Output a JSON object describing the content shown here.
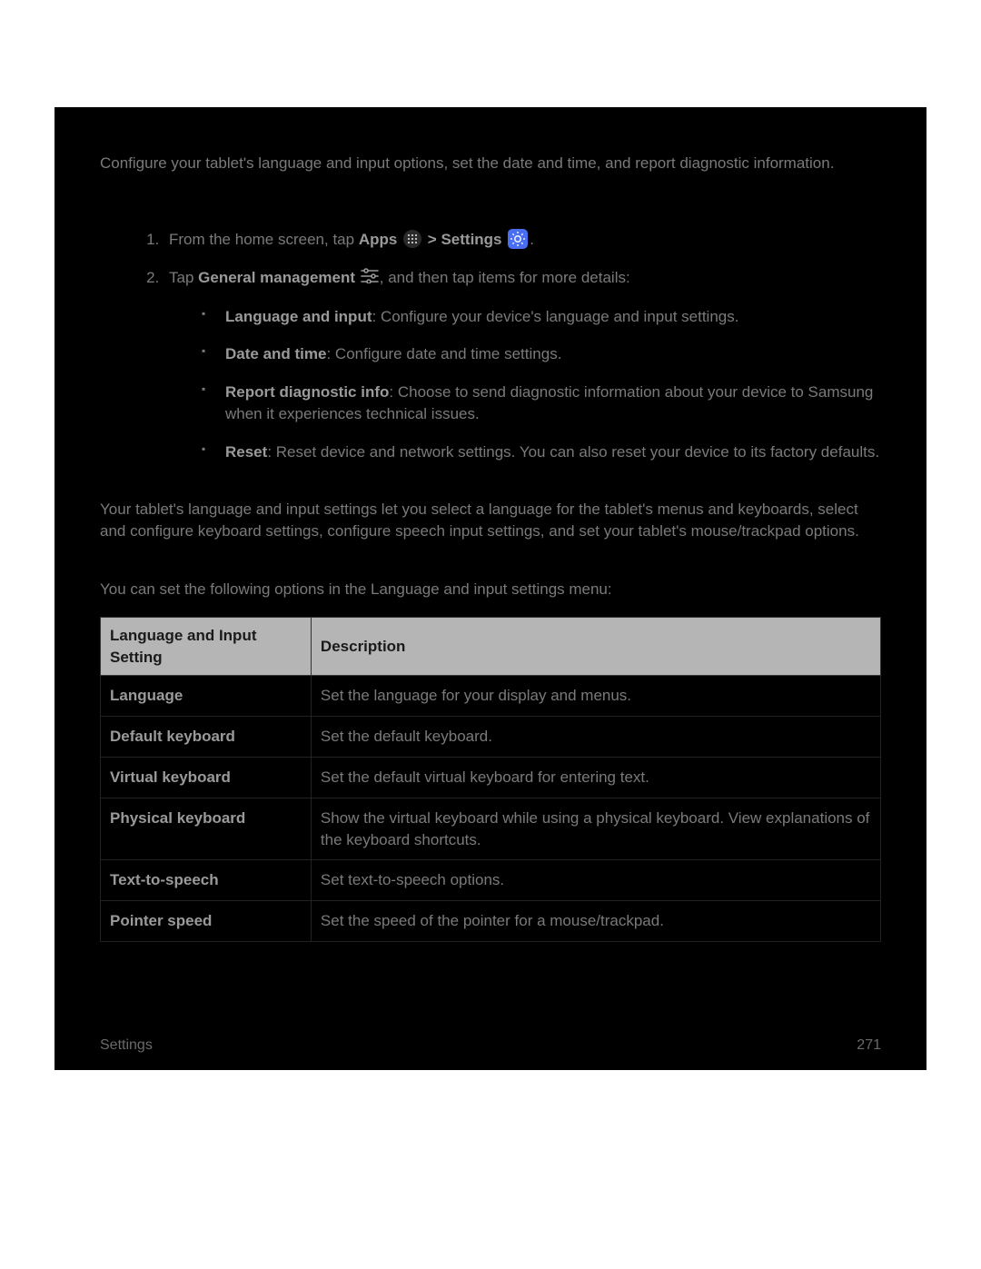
{
  "intro": "Configure your tablet's language and input options, set the date and time, and report diagnostic information.",
  "steps": {
    "s1": {
      "prefix": "From the home screen, tap ",
      "apps": "Apps",
      "sep": " > ",
      "settings": "Settings",
      "suffix": "."
    },
    "s2": {
      "prefix": "Tap ",
      "gm": "General management",
      "suffix": ", and then tap items for more details:"
    }
  },
  "bullets": [
    {
      "name": "Language and input",
      "desc": ": Configure your device's language and input settings."
    },
    {
      "name": "Date and time",
      "desc": ": Configure date and time settings."
    },
    {
      "name": "Report diagnostic info",
      "desc": ": Choose to send diagnostic information about your device to Samsung when it experiences technical issues."
    },
    {
      "name": "Reset",
      "desc": ": Reset device and network settings. You can also reset your device to its factory defaults."
    }
  ],
  "langInputIntro": "Your tablet's language and input settings let you select a language for the tablet's menus and keyboards, select and configure keyboard settings, configure speech input settings, and set your tablet's mouse/trackpad options.",
  "tableIntro": "You can set the following options in the Language and input settings menu:",
  "table": {
    "headers": {
      "col1": "Language and Input Setting",
      "col2": "Description"
    },
    "rows": [
      {
        "name": "Language",
        "desc": "Set the language for your display and menus."
      },
      {
        "name": "Default keyboard",
        "desc": "Set the default keyboard."
      },
      {
        "name": "Virtual keyboard",
        "desc": "Set the default virtual keyboard for entering text."
      },
      {
        "name": "Physical keyboard",
        "desc": "Show the virtual keyboard while using a physical keyboard. View explanations of the keyboard shortcuts."
      },
      {
        "name": "Text-to-speech",
        "desc": "Set text-to-speech options."
      },
      {
        "name": "Pointer speed",
        "desc": "Set the speed of the pointer for a mouse/trackpad."
      }
    ]
  },
  "footer": {
    "left": "Settings",
    "right": "271"
  }
}
